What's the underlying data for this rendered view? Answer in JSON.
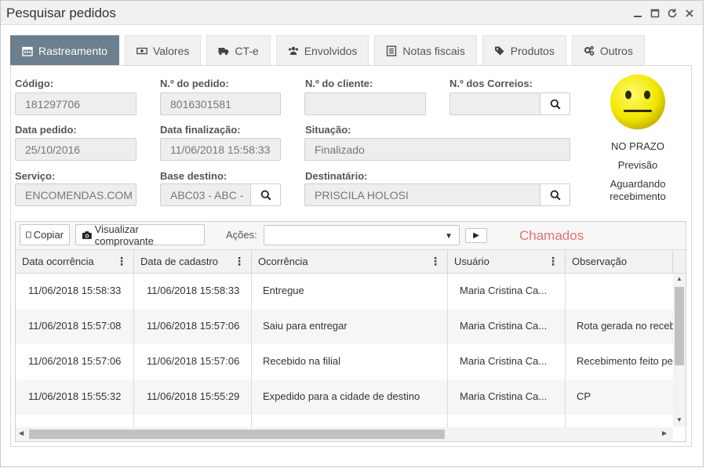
{
  "window": {
    "title": "Pesquisar pedidos",
    "controls": [
      "minimize-icon",
      "maximize-icon",
      "refresh-icon",
      "close-icon"
    ]
  },
  "tabs": [
    {
      "label": "Rastreamento",
      "icon": "calendar-icon",
      "active": true
    },
    {
      "label": "Valores",
      "icon": "money-icon"
    },
    {
      "label": "CT-e",
      "icon": "truck-icon"
    },
    {
      "label": "Envolvidos",
      "icon": "users-icon"
    },
    {
      "label": "Notas fiscais",
      "icon": "list-icon"
    },
    {
      "label": "Produtos",
      "icon": "tags-icon"
    },
    {
      "label": "Outros",
      "icon": "gears-icon"
    }
  ],
  "fields": {
    "codigo": {
      "label": "Código:",
      "value": "181297706"
    },
    "numero_pedido": {
      "label": "N.º do pedido:",
      "value": "8016301581"
    },
    "numero_cliente": {
      "label": "N.º do cliente:",
      "value": ""
    },
    "numero_correios": {
      "label": "N.º dos Correios:",
      "value": ""
    },
    "data_pedido": {
      "label": "Data pedido:",
      "value": "25/10/2016"
    },
    "data_finalizacao": {
      "label": "Data finalização:",
      "value": "11/06/2018 15:58:33"
    },
    "situacao": {
      "label": "Situação:",
      "value": "Finalizado"
    },
    "servico": {
      "label": "Serviço:",
      "value": "ENCOMENDAS.COM"
    },
    "base_destino": {
      "label": "Base destino:",
      "value": "ABC03 - ABC -"
    },
    "destinatario": {
      "label": "Destinatário:",
      "value": "PRISCILA HOLOSI"
    }
  },
  "status": {
    "face": "neutral-face-icon",
    "face_color": "#f2e600",
    "line1": "NO PRAZO",
    "line2": "Previsão",
    "line3": "Aguardando",
    "line4": "recebimento"
  },
  "toolbar": {
    "copy_label": "Copiar",
    "view_receipt_label": "Visualizar comprovante",
    "actions_label": "Ações:",
    "actions_value": "",
    "chamados_label": "Chamados",
    "chamados_color": "#e57373"
  },
  "table": {
    "columns": [
      "Data ocorrência",
      "Data de cadastro",
      "Ocorrência",
      "Usuário",
      "Observação"
    ],
    "rows": [
      [
        "11/06/2018 15:58:33",
        "11/06/2018 15:58:33",
        "Entregue",
        "Maria Cristina Ca...",
        ""
      ],
      [
        "11/06/2018 15:57:08",
        "11/06/2018 15:57:06",
        "Saiu para entregar",
        "Maria Cristina Ca...",
        "Rota gerada no receb"
      ],
      [
        "11/06/2018 15:57:06",
        "11/06/2018 15:57:06",
        "Recebido na filial",
        "Maria Cristina Ca...",
        "Recebimento feito pe"
      ],
      [
        "11/06/2018 15:55:32",
        "11/06/2018 15:55:29",
        "Expedido para a cidade de destino",
        "Maria Cristina Ca...",
        "CP"
      ]
    ]
  },
  "colors": {
    "active_tab": "#6b7f8e",
    "field_bg": "#eeeeee"
  }
}
